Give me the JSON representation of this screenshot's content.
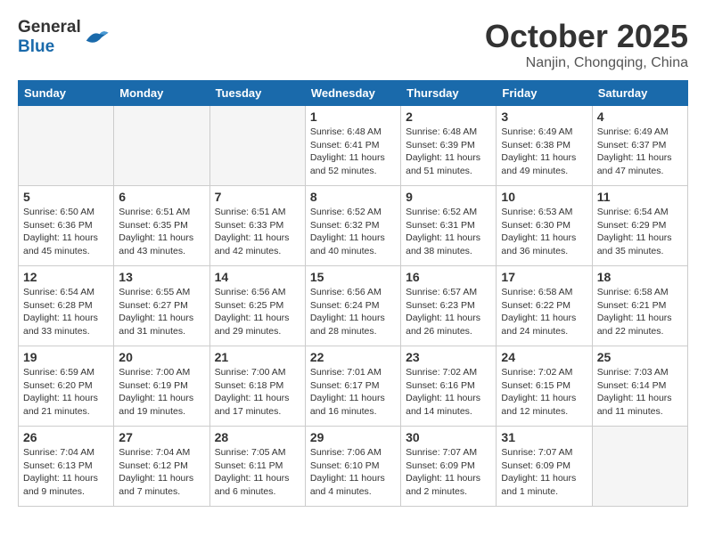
{
  "header": {
    "logo_general": "General",
    "logo_blue": "Blue",
    "month_title": "October 2025",
    "location": "Nanjin, Chongqing, China"
  },
  "days_of_week": [
    "Sunday",
    "Monday",
    "Tuesday",
    "Wednesday",
    "Thursday",
    "Friday",
    "Saturday"
  ],
  "weeks": [
    [
      {
        "num": "",
        "info": ""
      },
      {
        "num": "",
        "info": ""
      },
      {
        "num": "",
        "info": ""
      },
      {
        "num": "1",
        "info": "Sunrise: 6:48 AM\nSunset: 6:41 PM\nDaylight: 11 hours\nand 52 minutes."
      },
      {
        "num": "2",
        "info": "Sunrise: 6:48 AM\nSunset: 6:39 PM\nDaylight: 11 hours\nand 51 minutes."
      },
      {
        "num": "3",
        "info": "Sunrise: 6:49 AM\nSunset: 6:38 PM\nDaylight: 11 hours\nand 49 minutes."
      },
      {
        "num": "4",
        "info": "Sunrise: 6:49 AM\nSunset: 6:37 PM\nDaylight: 11 hours\nand 47 minutes."
      }
    ],
    [
      {
        "num": "5",
        "info": "Sunrise: 6:50 AM\nSunset: 6:36 PM\nDaylight: 11 hours\nand 45 minutes."
      },
      {
        "num": "6",
        "info": "Sunrise: 6:51 AM\nSunset: 6:35 PM\nDaylight: 11 hours\nand 43 minutes."
      },
      {
        "num": "7",
        "info": "Sunrise: 6:51 AM\nSunset: 6:33 PM\nDaylight: 11 hours\nand 42 minutes."
      },
      {
        "num": "8",
        "info": "Sunrise: 6:52 AM\nSunset: 6:32 PM\nDaylight: 11 hours\nand 40 minutes."
      },
      {
        "num": "9",
        "info": "Sunrise: 6:52 AM\nSunset: 6:31 PM\nDaylight: 11 hours\nand 38 minutes."
      },
      {
        "num": "10",
        "info": "Sunrise: 6:53 AM\nSunset: 6:30 PM\nDaylight: 11 hours\nand 36 minutes."
      },
      {
        "num": "11",
        "info": "Sunrise: 6:54 AM\nSunset: 6:29 PM\nDaylight: 11 hours\nand 35 minutes."
      }
    ],
    [
      {
        "num": "12",
        "info": "Sunrise: 6:54 AM\nSunset: 6:28 PM\nDaylight: 11 hours\nand 33 minutes."
      },
      {
        "num": "13",
        "info": "Sunrise: 6:55 AM\nSunset: 6:27 PM\nDaylight: 11 hours\nand 31 minutes."
      },
      {
        "num": "14",
        "info": "Sunrise: 6:56 AM\nSunset: 6:25 PM\nDaylight: 11 hours\nand 29 minutes."
      },
      {
        "num": "15",
        "info": "Sunrise: 6:56 AM\nSunset: 6:24 PM\nDaylight: 11 hours\nand 28 minutes."
      },
      {
        "num": "16",
        "info": "Sunrise: 6:57 AM\nSunset: 6:23 PM\nDaylight: 11 hours\nand 26 minutes."
      },
      {
        "num": "17",
        "info": "Sunrise: 6:58 AM\nSunset: 6:22 PM\nDaylight: 11 hours\nand 24 minutes."
      },
      {
        "num": "18",
        "info": "Sunrise: 6:58 AM\nSunset: 6:21 PM\nDaylight: 11 hours\nand 22 minutes."
      }
    ],
    [
      {
        "num": "19",
        "info": "Sunrise: 6:59 AM\nSunset: 6:20 PM\nDaylight: 11 hours\nand 21 minutes."
      },
      {
        "num": "20",
        "info": "Sunrise: 7:00 AM\nSunset: 6:19 PM\nDaylight: 11 hours\nand 19 minutes."
      },
      {
        "num": "21",
        "info": "Sunrise: 7:00 AM\nSunset: 6:18 PM\nDaylight: 11 hours\nand 17 minutes."
      },
      {
        "num": "22",
        "info": "Sunrise: 7:01 AM\nSunset: 6:17 PM\nDaylight: 11 hours\nand 16 minutes."
      },
      {
        "num": "23",
        "info": "Sunrise: 7:02 AM\nSunset: 6:16 PM\nDaylight: 11 hours\nand 14 minutes."
      },
      {
        "num": "24",
        "info": "Sunrise: 7:02 AM\nSunset: 6:15 PM\nDaylight: 11 hours\nand 12 minutes."
      },
      {
        "num": "25",
        "info": "Sunrise: 7:03 AM\nSunset: 6:14 PM\nDaylight: 11 hours\nand 11 minutes."
      }
    ],
    [
      {
        "num": "26",
        "info": "Sunrise: 7:04 AM\nSunset: 6:13 PM\nDaylight: 11 hours\nand 9 minutes."
      },
      {
        "num": "27",
        "info": "Sunrise: 7:04 AM\nSunset: 6:12 PM\nDaylight: 11 hours\nand 7 minutes."
      },
      {
        "num": "28",
        "info": "Sunrise: 7:05 AM\nSunset: 6:11 PM\nDaylight: 11 hours\nand 6 minutes."
      },
      {
        "num": "29",
        "info": "Sunrise: 7:06 AM\nSunset: 6:10 PM\nDaylight: 11 hours\nand 4 minutes."
      },
      {
        "num": "30",
        "info": "Sunrise: 7:07 AM\nSunset: 6:09 PM\nDaylight: 11 hours\nand 2 minutes."
      },
      {
        "num": "31",
        "info": "Sunrise: 7:07 AM\nSunset: 6:09 PM\nDaylight: 11 hours\nand 1 minute."
      },
      {
        "num": "",
        "info": ""
      }
    ]
  ]
}
